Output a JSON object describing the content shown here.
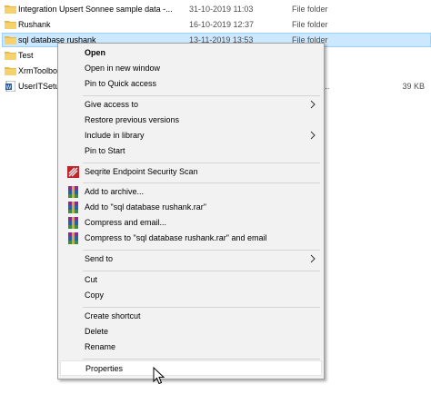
{
  "files": [
    {
      "name": "Integration Upsert  Sonnee sample data -...",
      "date": "31-10-2019 11:03",
      "type": "File folder",
      "size": "",
      "icon": "folder-icon"
    },
    {
      "name": "Rushank",
      "date": "16-10-2019 12:37",
      "type": "File folder",
      "size": "",
      "icon": "folder-icon"
    },
    {
      "name": "sql database rushank",
      "date": "13-11-2019 13:53",
      "type": "File folder",
      "size": "",
      "icon": "folder-icon",
      "selected": true
    },
    {
      "name": "Test",
      "date": "",
      "type": "",
      "size": "",
      "icon": "folder-icon"
    },
    {
      "name": "XrmToolbo",
      "date": "",
      "type": "",
      "size": "",
      "icon": "folder-icon"
    },
    {
      "name": "UserITSetu",
      "date": "",
      "type": "t Word 9...",
      "size": "39 KB",
      "icon": "word-doc-icon"
    }
  ],
  "menu": {
    "open": "Open",
    "open_new_window": "Open in new window",
    "pin_quick_access": "Pin to Quick access",
    "give_access": "Give access to",
    "restore_versions": "Restore previous versions",
    "include_library": "Include in library",
    "pin_start": "Pin to Start",
    "seqrite_scan": "Seqrite Endpoint Security Scan",
    "add_archive": "Add to archive...",
    "add_rar": "Add to \"sql database rushank.rar\"",
    "compress_email": "Compress and email...",
    "compress_rar_email": "Compress to \"sql database rushank.rar\" and email",
    "send_to": "Send to",
    "cut": "Cut",
    "copy": "Copy",
    "create_shortcut": "Create shortcut",
    "delete": "Delete",
    "rename": "Rename",
    "properties": "Properties"
  },
  "colors": {
    "selection": "#cce8ff",
    "menu_bg": "#f2f2f2",
    "folder": "#e8b94a"
  }
}
